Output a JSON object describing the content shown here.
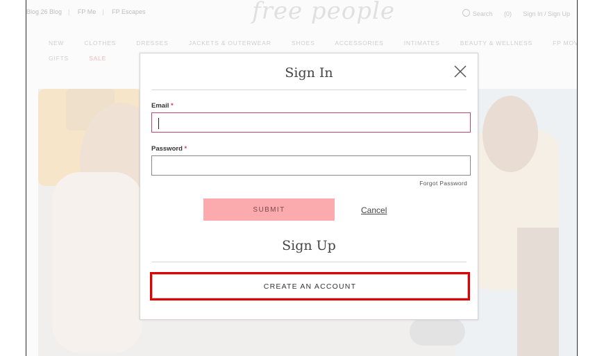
{
  "header": {
    "utility_links": [
      "Blog 26 Blog",
      "FP Me",
      "FP Escapes"
    ],
    "logo_text": "free people",
    "search_label": "Search",
    "cart_count": "(0)",
    "account_label": "Sign In / Sign Up"
  },
  "nav": {
    "row1": [
      "NEW",
      "CLOTHES",
      "DRESSES",
      "JACKETS & OUTERWEAR",
      "SHOES",
      "ACCESSORIES",
      "INTIMATES",
      "BEAUTY & WELLNESS",
      "FP MOVEMENT"
    ],
    "row2": [
      "GIFTS",
      "SALE"
    ]
  },
  "modal": {
    "title": "Sign In",
    "email_label": "Email",
    "password_label": "Password",
    "required_mark": "*",
    "email_value": "",
    "password_value": "",
    "forgot_label": "Forgot Password",
    "submit_label": "SUBMIT",
    "cancel_label": "Cancel",
    "signup_title": "Sign Up",
    "create_label": "CREATE AN ACCOUNT"
  },
  "colors": {
    "submit_bg": "#fbabad",
    "focus_border": "#c0446f",
    "highlight": "#e00000"
  }
}
